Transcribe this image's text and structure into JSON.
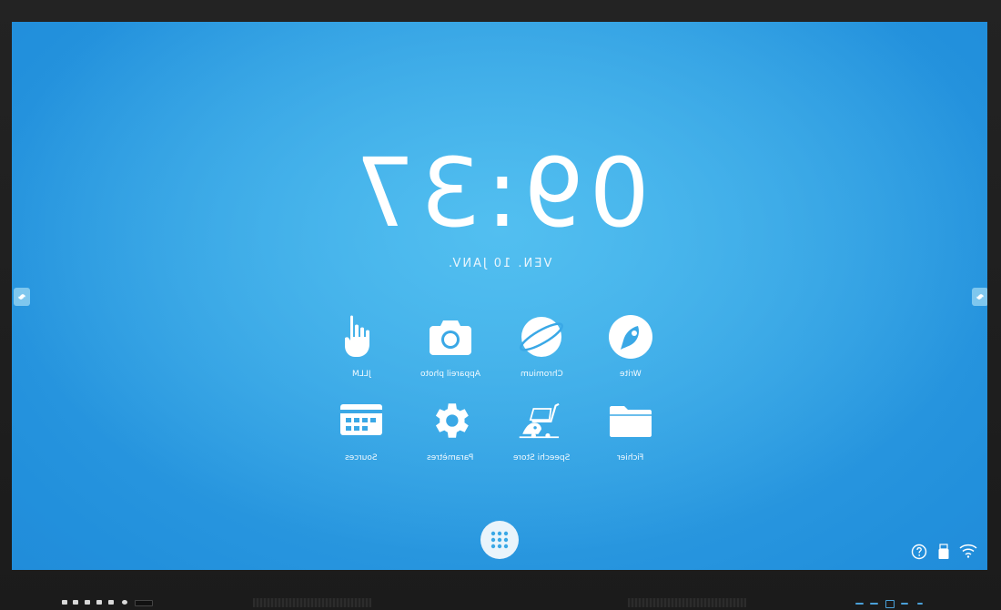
{
  "clock": {
    "time": "09:37",
    "date": "VEN. 10 JANV."
  },
  "apps": [
    {
      "label": "Write",
      "icon": "write-icon"
    },
    {
      "label": "Chromium",
      "icon": "chromium-icon"
    },
    {
      "label": "Appareil photo",
      "icon": "camera-icon"
    },
    {
      "label": "JLLM",
      "icon": "hand-icon"
    },
    {
      "label": "Fichier",
      "icon": "folder-icon"
    },
    {
      "label": "Speechi Store",
      "icon": "store-icon"
    },
    {
      "label": "Paramètres",
      "icon": "gear-icon"
    },
    {
      "label": "Sources",
      "icon": "sources-icon"
    }
  ],
  "colors": {
    "screen": "#2290dc",
    "accent": "#52bff0",
    "bezel": "#1e1e1e"
  },
  "status_icons": [
    "help-icon",
    "usb-icon",
    "wifi-icon"
  ]
}
